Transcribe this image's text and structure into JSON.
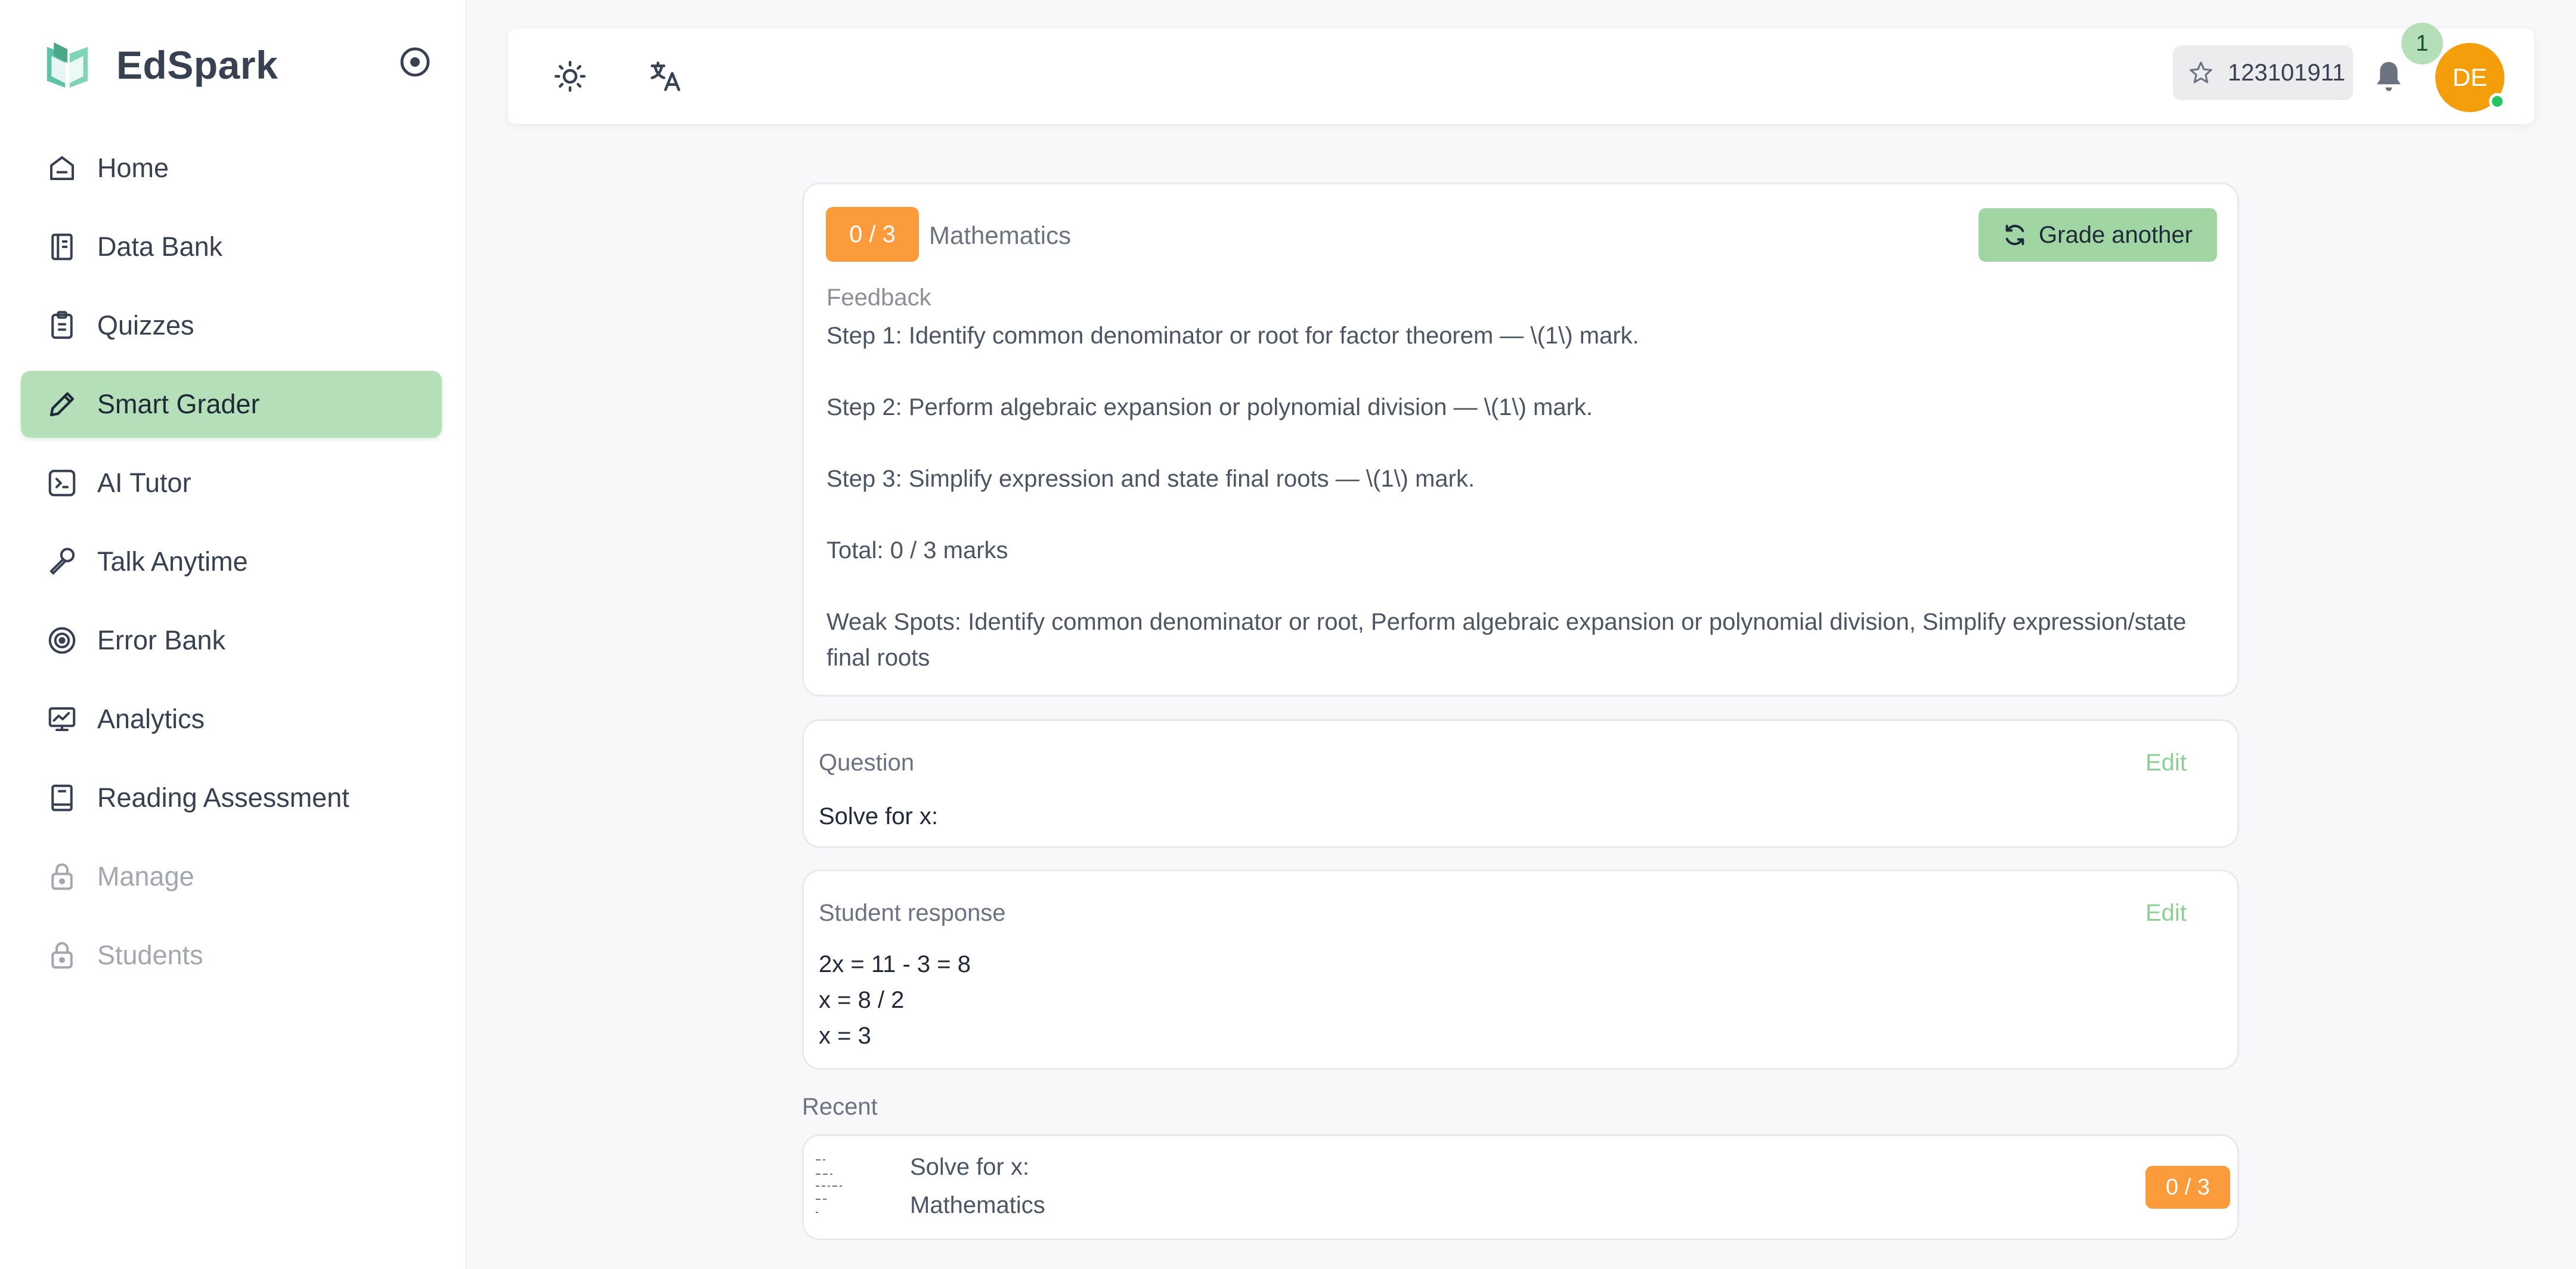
{
  "app": {
    "name": "EdSpark"
  },
  "colors": {
    "accent": "#b5dfb8",
    "score": "#fb9b3c",
    "avatar": "#f59e0b",
    "online": "#22c55e"
  },
  "sidebar": {
    "items": [
      {
        "label": "Home",
        "icon": "home-icon"
      },
      {
        "label": "Data Bank",
        "icon": "book-icon"
      },
      {
        "label": "Quizzes",
        "icon": "clipboard-icon"
      },
      {
        "label": "Smart Grader",
        "icon": "pencil-icon",
        "active": true
      },
      {
        "label": "AI Tutor",
        "icon": "terminal-icon"
      },
      {
        "label": "Talk Anytime",
        "icon": "microphone-icon"
      },
      {
        "label": "Error Bank",
        "icon": "target-icon"
      },
      {
        "label": "Analytics",
        "icon": "chart-icon"
      },
      {
        "label": "Reading Assessment",
        "icon": "book-closed-icon"
      },
      {
        "label": "Manage",
        "icon": "lock-icon",
        "locked": true
      },
      {
        "label": "Students",
        "icon": "lock-icon",
        "locked": true
      }
    ]
  },
  "topbar": {
    "points": "123101911",
    "notifications": "1",
    "avatar_initials": "DE"
  },
  "result": {
    "score": "0 / 3",
    "subject": "Mathematics",
    "grade_another_label": "Grade another",
    "feedback_label": "Feedback",
    "feedback_lines": [
      "Step 1: Identify common denominator or root for factor theorem — \\(1\\) mark.",
      "Step 2: Perform algebraic expansion or polynomial division — \\(1\\) mark.",
      "Step 3: Simplify expression and state final roots — \\(1\\) mark.",
      "Total: 0 / 3 marks",
      "Weak Spots: Identify common denominator or root, Perform algebraic expansion or polynomial division, Simplify expression/state final roots"
    ]
  },
  "question": {
    "label": "Question",
    "edit_label": "Edit",
    "text": "Solve for x:"
  },
  "student_response": {
    "label": "Student response",
    "edit_label": "Edit",
    "lines": [
      "2x = 11 - 3 = 8",
      "x = 8 / 2",
      "x = 3"
    ]
  },
  "recent": {
    "label": "Recent",
    "items": [
      {
        "title": "Solve for x:",
        "subject": "Mathematics",
        "score": "0 / 3"
      }
    ]
  }
}
